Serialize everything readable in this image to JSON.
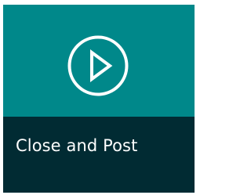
{
  "tile": {
    "label": "Close and Post",
    "icon": "play-circle-icon",
    "colors": {
      "top": "#00888a",
      "bottom": "#012b33",
      "text": "#ffffff",
      "icon": "#ffffff"
    }
  }
}
